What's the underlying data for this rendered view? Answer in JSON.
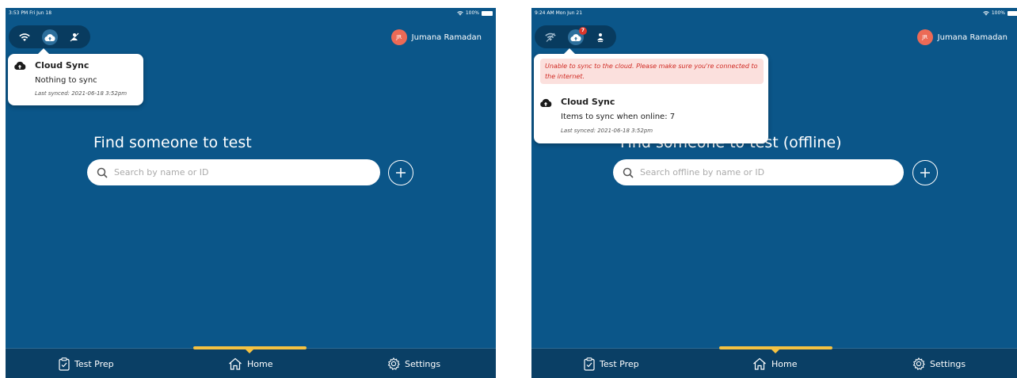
{
  "colors": {
    "background": "#0b5689",
    "bottom_bar": "#0a3f65",
    "accent": "#f5c242",
    "avatar": "#ec6a56",
    "error_bg": "#fbe0dd",
    "error_text": "#d02a23",
    "badge": "#d9362b"
  },
  "screens": [
    {
      "status_time": "3:53 PM  Fri Jun 18",
      "status_battery": "100%",
      "connectivity": {
        "icons": [
          "wifi-icon",
          "cloud-sync-icon",
          "sync-user-icon"
        ]
      },
      "user": {
        "initials": "JR",
        "name": "Jumana Ramadan"
      },
      "popover": {
        "title": "Cloud Sync",
        "message": "Nothing to sync",
        "last_synced": "Last synced: 2021-06-18 3:52pm"
      },
      "find_title": "Find someone to test",
      "search_placeholder": "Search by name or ID",
      "tabs": [
        {
          "label": "Test Prep",
          "icon": "clipboard-icon"
        },
        {
          "label": "Home",
          "icon": "home-icon"
        },
        {
          "label": "Settings",
          "icon": "gear-icon"
        }
      ],
      "active_tab": "Home"
    },
    {
      "status_time": "9:24 AM  Mon Jun 21",
      "status_battery": "100%",
      "connectivity": {
        "icons": [
          "wifi-off-icon",
          "cloud-sync-icon",
          "sync-user-icon"
        ],
        "badge_count": "7"
      },
      "user": {
        "initials": "JR",
        "name": "Jumana Ramadan"
      },
      "popover": {
        "error": "Unable to sync to the cloud. Please make sure you're connected to the internet.",
        "title": "Cloud Sync",
        "message": "Items to sync when online: 7",
        "last_synced": "Last synced: 2021-06-18 3:52pm"
      },
      "find_title": "Find someone to test (offline)",
      "search_placeholder": "Search offline by name or ID",
      "tabs": [
        {
          "label": "Test Prep",
          "icon": "clipboard-icon"
        },
        {
          "label": "Home",
          "icon": "home-icon"
        },
        {
          "label": "Settings",
          "icon": "gear-icon"
        }
      ],
      "active_tab": "Home"
    }
  ]
}
